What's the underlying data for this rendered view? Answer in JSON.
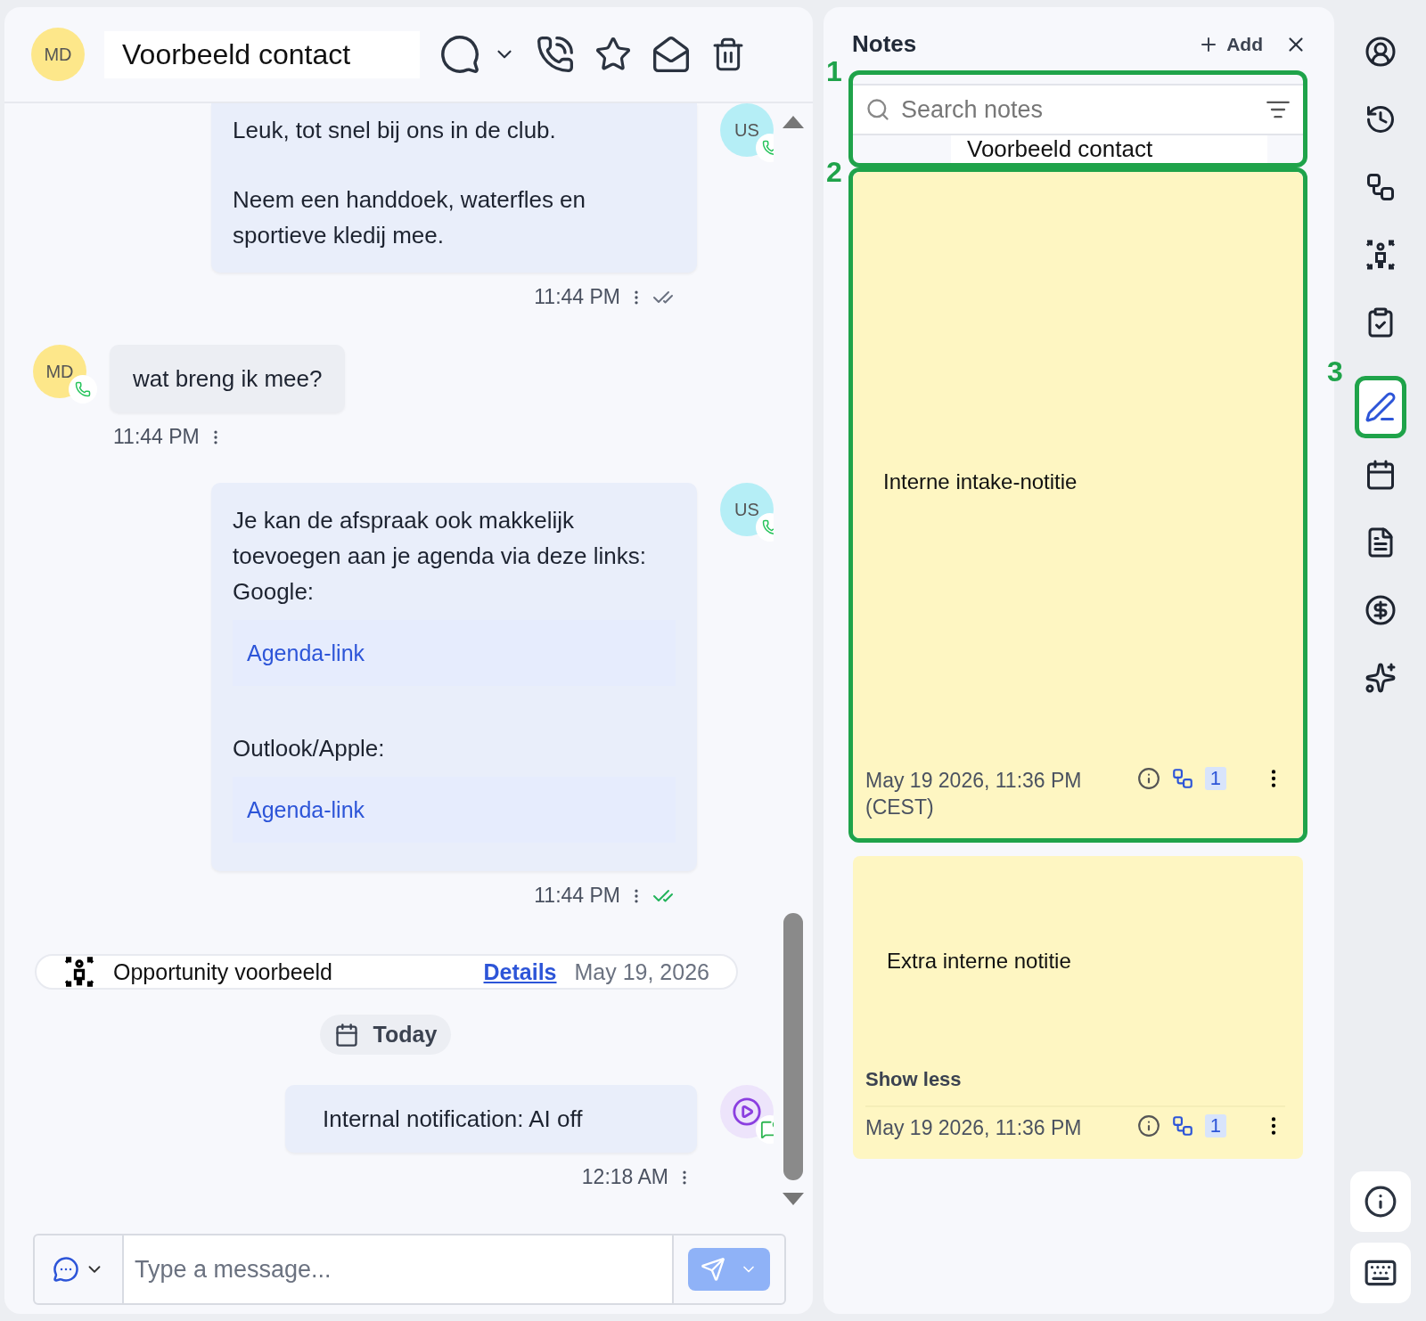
{
  "contact": {
    "initials": "MD",
    "name": "Voorbeeld contact"
  },
  "messages": [
    {
      "kind": "outgoing",
      "avatar": "US",
      "read": false,
      "time": "11:44 PM",
      "parts": [
        {
          "kind": "text",
          "text": "Leuk, tot snel bij ons in de club."
        },
        {
          "kind": "gap"
        },
        {
          "kind": "text",
          "text": "Neem een handdoek, waterfles en sportieve kledij mee."
        }
      ]
    },
    {
      "kind": "incoming",
      "avatar": "MD",
      "time": "11:44 PM",
      "parts": [
        {
          "kind": "text",
          "text": "wat breng ik mee?"
        }
      ]
    },
    {
      "kind": "outgoing",
      "avatar": "US",
      "read": true,
      "time": "11:44 PM",
      "parts": [
        {
          "kind": "text",
          "text": "Je kan de afspraak ook makkelijk toevoegen aan je agenda via deze links:"
        },
        {
          "kind": "text",
          "text": "Google:"
        },
        {
          "kind": "link",
          "text": "Agenda-link"
        },
        {
          "kind": "gap"
        },
        {
          "kind": "text",
          "text": "Outlook/Apple:"
        },
        {
          "kind": "link",
          "text": "Agenda-link"
        }
      ]
    },
    {
      "kind": "event",
      "title": "Opportunity voorbeeld",
      "link": "Details",
      "date": "May 19, 2026"
    },
    {
      "kind": "divider",
      "label": "Today"
    },
    {
      "kind": "internal",
      "time": "12:18 AM",
      "parts": [
        {
          "kind": "text",
          "text": "Internal notification: AI off"
        }
      ]
    }
  ],
  "composer": {
    "placeholder": "Type a message..."
  },
  "notes": {
    "title": "Notes",
    "add": "Add",
    "search": {
      "placeholder": "Search notes",
      "filter": "Voorbeeld contact",
      "callout": "1"
    },
    "items": [
      {
        "body": "Interne intake-notitie",
        "date": "May 19 2026, 11:36 PM (CEST)",
        "count": "1",
        "callout": "2"
      },
      {
        "body": "Extra interne notitie",
        "toggle": "Show less",
        "date": "May 19 2026, 11:36 PM",
        "count": "1"
      }
    ]
  },
  "rail": [
    {
      "kind": "profile",
      "selected": false
    },
    {
      "kind": "history",
      "selected": false
    },
    {
      "kind": "workflow",
      "selected": false
    },
    {
      "kind": "opportunity",
      "selected": false
    },
    {
      "kind": "tasks",
      "selected": false
    },
    {
      "kind": "notes",
      "selected": true,
      "callout": "3"
    },
    {
      "kind": "calendar",
      "selected": false
    },
    {
      "kind": "document",
      "selected": false
    },
    {
      "kind": "payments",
      "selected": false
    },
    {
      "kind": "ai",
      "selected": false
    }
  ],
  "rail_bottom": [
    {
      "kind": "info"
    },
    {
      "kind": "keyboard"
    }
  ]
}
